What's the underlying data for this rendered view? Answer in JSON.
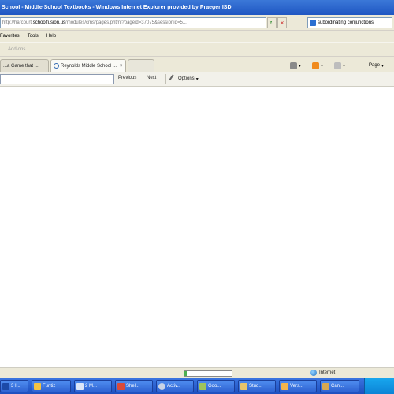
{
  "window": {
    "title": "School - Middle School Textbooks - Windows Internet Explorer provided by Praeger ISD"
  },
  "address": {
    "prefix": "http://harcourt.",
    "host": "schoolfusion.us",
    "suffix": "/modules/cms/pages.phtml?pageid=37075&sessionid=5...",
    "search_value": "subordinating conjunctions"
  },
  "menu": {
    "items": [
      "Favorites",
      "Tools",
      "Help"
    ]
  },
  "links_bar": {
    "addon_label": "Add-ons"
  },
  "tabs": [
    {
      "label": "...a Game that ..."
    },
    {
      "label": "Reynolds Middle School ...",
      "close": "×"
    }
  ],
  "command_bar": {
    "page_label": "Page"
  },
  "find_bar": {
    "previous_label": "Previous",
    "next_label": "Next",
    "options_label": "Options"
  },
  "status_bar": {
    "progress": 0.05,
    "zone_label": "Internet"
  },
  "taskbar": {
    "items": [
      {
        "label": "3 I..."
      },
      {
        "label": "Funtiz"
      },
      {
        "label": "2 M..."
      },
      {
        "label": "Shel..."
      },
      {
        "label": "Activ..."
      },
      {
        "label": "Goo..."
      },
      {
        "label": "Stud..."
      },
      {
        "label": "Vers..."
      },
      {
        "label": "Can..."
      }
    ]
  }
}
